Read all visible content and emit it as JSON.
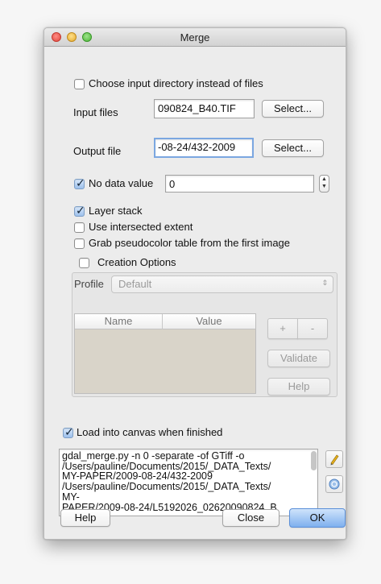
{
  "window": {
    "title": "Merge"
  },
  "options": {
    "choose_dir_label": "Choose input directory instead of files",
    "input_files_label": "Input files",
    "input_files_value": "090824_B40.TIF",
    "select_label": "Select...",
    "output_file_label": "Output file",
    "output_file_value": "-08-24/432-2009",
    "no_data_label": "No data value",
    "no_data_value": "0",
    "layer_stack_label": "Layer stack",
    "intersected_label": "Use intersected extent",
    "pseudocolor_label": "Grab pseudocolor table from the first image"
  },
  "creation": {
    "label": "Creation Options",
    "profile_label": "Profile",
    "profile_value": "Default",
    "col_name": "Name",
    "col_value": "Value",
    "add_label": "+",
    "remove_label": "-",
    "validate_label": "Validate",
    "help_label": "Help"
  },
  "load_canvas_label": "Load into canvas when finished",
  "command": {
    "lines": [
      "gdal_merge.py -n 0 -separate -of GTiff -o",
      "/Users/pauline/Documents/2015/_DATA_Texts/",
      "MY-PAPER/2009-08-24/432-2009",
      "/Users/pauline/Documents/2015/_DATA_Texts/",
      "MY-",
      "PAPER/2009-08-24/L5192026_02620090824_B"
    ]
  },
  "footer": {
    "help_label": "Help",
    "close_label": "Close",
    "ok_label": "OK"
  },
  "checks": {
    "choose_dir": false,
    "no_data": true,
    "layer_stack": true,
    "intersected": false,
    "pseudocolor": false,
    "creation": false,
    "load_canvas": true
  },
  "icons": {
    "edit": "pencil-icon",
    "reset": "reset-icon"
  }
}
